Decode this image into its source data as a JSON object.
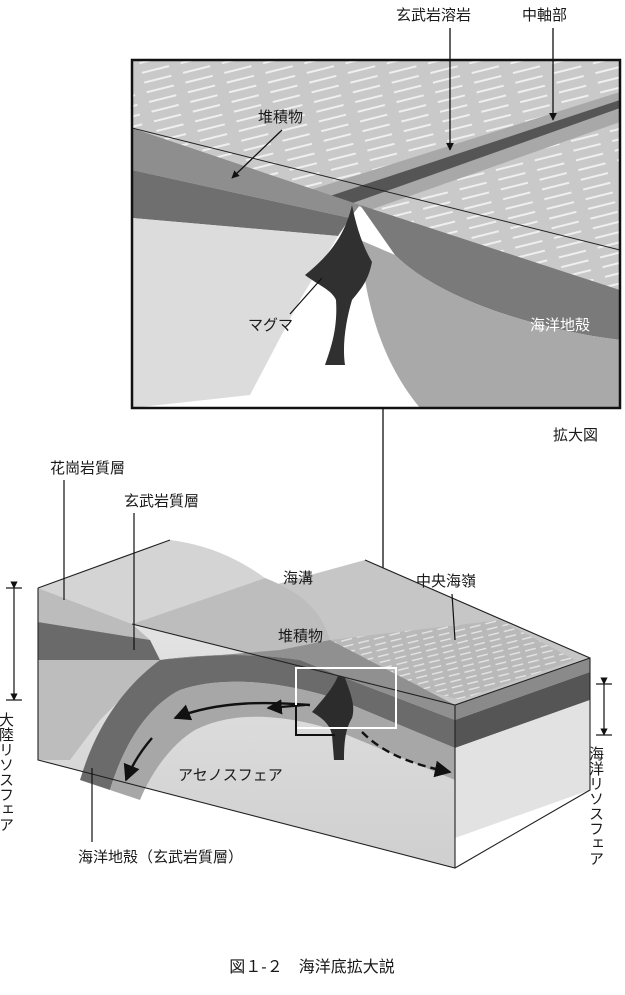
{
  "figure": {
    "caption": "図１-２　海洋底拡大説"
  },
  "inset": {
    "basalt_lava": "玄武岩溶岩",
    "axial_zone": "中軸部",
    "sediment": "堆積物",
    "magma": "マグマ",
    "oceanic_crust": "海洋地殻",
    "title": "拡大図"
  },
  "main": {
    "granite_layer": "花崗岩質層",
    "basalt_layer": "玄武岩質層",
    "trench": "海溝",
    "ridge": "中央海嶺",
    "sediment": "堆積物",
    "asthenosphere": "アセノスフェア",
    "oceanic_crust_basalt": "海洋地殻（玄武岩質層）",
    "continental_lithosphere": "大陸リソスフェア",
    "oceanic_lithosphere": "海洋リソスフェア"
  }
}
